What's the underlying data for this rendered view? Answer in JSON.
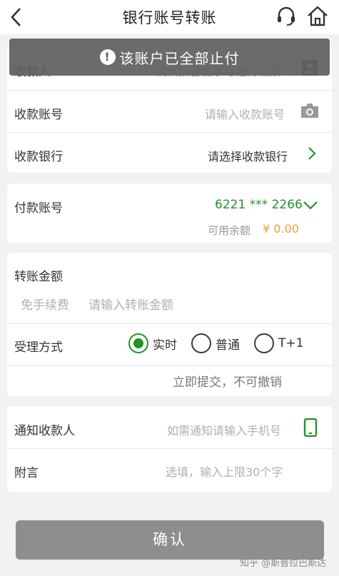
{
  "nav": {
    "title": "银行账号转账"
  },
  "toast": {
    "icon": "!",
    "message": "该账户已全部止付"
  },
  "payee": {
    "name_label": "收款人",
    "name_placeholder": "试试拼音首字母进行检索",
    "account_label": "收款账号",
    "account_placeholder": "请输入收款账号",
    "bank_label": "收款银行",
    "bank_placeholder": "请选择收款银行"
  },
  "payer": {
    "account_label": "付款账号",
    "account_number": "6221 *** 2266",
    "balance_label": "可用余额",
    "balance_value": "¥ 0.00"
  },
  "amount": {
    "label": "转账金额",
    "fee_note": "免手续费",
    "placeholder": "请输入转账金额",
    "method_label": "受理方式",
    "options": [
      {
        "label": "实时",
        "selected": true
      },
      {
        "label": "普通",
        "selected": false
      },
      {
        "label": "T+1",
        "selected": false
      }
    ],
    "method_note": "立即提交，不可撤销"
  },
  "notify": {
    "label": "通知收款人",
    "placeholder": "如需通知请输入手机号",
    "message_label": "附言",
    "message_placeholder": "选填，输入上限30个字"
  },
  "confirm_label": "确认",
  "watermark": "知乎 @斯普拉巴斯达",
  "colors": {
    "accent_green": "#22922b",
    "amount_orange": "#e6a23c",
    "toast_bg": "#606060",
    "button_disabled": "#8e8e8e"
  },
  "icons": [
    "back-arrow-icon",
    "headset-icon",
    "home-icon",
    "contact-book-icon",
    "camera-icon",
    "chevron-right-icon",
    "chevron-down-icon",
    "phone-icon"
  ]
}
